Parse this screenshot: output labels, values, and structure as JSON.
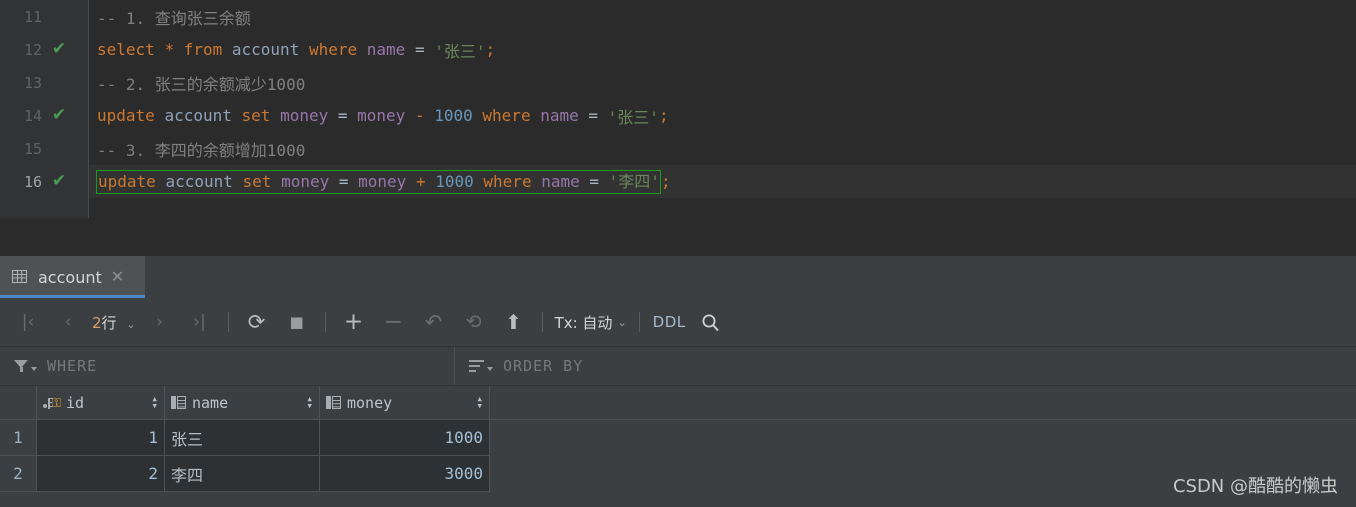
{
  "editor": {
    "lines": [
      {
        "number": "11",
        "executed": false,
        "selected": false,
        "tokens": [
          {
            "t": "cmt",
            "v": "-- 1. 查询张三余额"
          }
        ]
      },
      {
        "number": "12",
        "executed": true,
        "selected": false,
        "tokens": [
          {
            "t": "kw",
            "v": "select"
          },
          {
            "t": "op",
            "v": " "
          },
          {
            "t": "kw",
            "v": "*"
          },
          {
            "t": "op",
            "v": " "
          },
          {
            "t": "kw",
            "v": "from"
          },
          {
            "t": "op",
            "v": " "
          },
          {
            "t": "tbl",
            "v": "account"
          },
          {
            "t": "op",
            "v": " "
          },
          {
            "t": "kw",
            "v": "where"
          },
          {
            "t": "op",
            "v": " "
          },
          {
            "t": "col",
            "v": "name"
          },
          {
            "t": "op",
            "v": " = "
          },
          {
            "t": "str",
            "v": "'张三'"
          },
          {
            "t": "punc",
            "v": ";"
          }
        ]
      },
      {
        "number": "13",
        "executed": false,
        "selected": false,
        "tokens": [
          {
            "t": "cmt",
            "v": "-- 2. 张三的余额减少1000"
          }
        ]
      },
      {
        "number": "14",
        "executed": true,
        "selected": false,
        "tokens": [
          {
            "t": "kw",
            "v": "update"
          },
          {
            "t": "op",
            "v": " "
          },
          {
            "t": "tbl",
            "v": "account"
          },
          {
            "t": "op",
            "v": " "
          },
          {
            "t": "kw",
            "v": "set"
          },
          {
            "t": "op",
            "v": " "
          },
          {
            "t": "col",
            "v": "money"
          },
          {
            "t": "op",
            "v": " = "
          },
          {
            "t": "col",
            "v": "money"
          },
          {
            "t": "op",
            "v": " "
          },
          {
            "t": "punc",
            "v": "-"
          },
          {
            "t": "op",
            "v": " "
          },
          {
            "t": "num",
            "v": "1000"
          },
          {
            "t": "op",
            "v": " "
          },
          {
            "t": "kw",
            "v": "where"
          },
          {
            "t": "op",
            "v": " "
          },
          {
            "t": "col",
            "v": "name"
          },
          {
            "t": "op",
            "v": " = "
          },
          {
            "t": "str",
            "v": "'张三'"
          },
          {
            "t": "punc",
            "v": ";"
          }
        ]
      },
      {
        "number": "15",
        "executed": false,
        "selected": false,
        "tokens": [
          {
            "t": "cmt",
            "v": "-- 3. 李四的余额增加1000"
          }
        ]
      },
      {
        "number": "16",
        "executed": true,
        "selected": true,
        "boxed_tokens": [
          {
            "t": "kw",
            "v": "update"
          },
          {
            "t": "op",
            "v": " "
          },
          {
            "t": "tbl",
            "v": "account"
          },
          {
            "t": "op",
            "v": " "
          },
          {
            "t": "kw",
            "v": "set"
          },
          {
            "t": "op",
            "v": " "
          },
          {
            "t": "col",
            "v": "money"
          },
          {
            "t": "op",
            "v": " = "
          },
          {
            "t": "col",
            "v": "money"
          },
          {
            "t": "op",
            "v": " "
          },
          {
            "t": "punc",
            "v": "+"
          },
          {
            "t": "op",
            "v": " "
          },
          {
            "t": "num",
            "v": "1000"
          },
          {
            "t": "op",
            "v": " "
          },
          {
            "t": "kw",
            "v": "where"
          },
          {
            "t": "op",
            "v": " "
          },
          {
            "t": "col",
            "v": "name"
          },
          {
            "t": "op",
            "v": " = "
          },
          {
            "t": "str",
            "v": "'李四'"
          }
        ],
        "tokens": [
          {
            "t": "punc",
            "v": ";"
          }
        ]
      }
    ],
    "check_glyph": "✔",
    "colors": {
      "background": "#2b2b2b",
      "gutter": "#313335",
      "keyword": "#cc7832",
      "string": "#6a8759",
      "number": "#6897bb",
      "column": "#9876aa",
      "comment": "#808080",
      "executed_check": "#499c54",
      "statement_box": "#1a9e1a"
    }
  },
  "result_panel": {
    "tab": {
      "label": "account",
      "close_glyph": "✕",
      "accent": "#4a88c7"
    },
    "toolbar": {
      "first_page": "|‹",
      "prev_page": "‹",
      "rows_count": "2",
      "rows_unit": "行",
      "rows_chevron": "⌄",
      "next_page": "›",
      "last_page": "›|",
      "reload": "⟳",
      "stop": "■",
      "add_row": "+",
      "delete_row": "−",
      "revert": "↶",
      "submit": "⟲",
      "upload": "⬆",
      "tx_label": "Tx: 自动",
      "tx_chevron": "⌄",
      "ddl_label": "DDL",
      "search": "🔍"
    },
    "filters": {
      "where_label": "WHERE",
      "order_by_label": "ORDER BY"
    },
    "grid": {
      "columns": [
        {
          "key": "rownum",
          "label": "",
          "icon": "none"
        },
        {
          "key": "id",
          "label": "id",
          "icon": "primary-key"
        },
        {
          "key": "name",
          "label": "name",
          "icon": "column"
        },
        {
          "key": "money",
          "label": "money",
          "icon": "column"
        }
      ],
      "sort_glyph_up": "▴",
      "sort_glyph_down": "▾",
      "rows": [
        {
          "rownum": "1",
          "id": "1",
          "name": "张三",
          "money": "1000"
        },
        {
          "rownum": "2",
          "id": "2",
          "name": "李四",
          "money": "3000"
        }
      ]
    }
  },
  "watermark": {
    "text": "CSDN @酷酷的懒虫"
  }
}
